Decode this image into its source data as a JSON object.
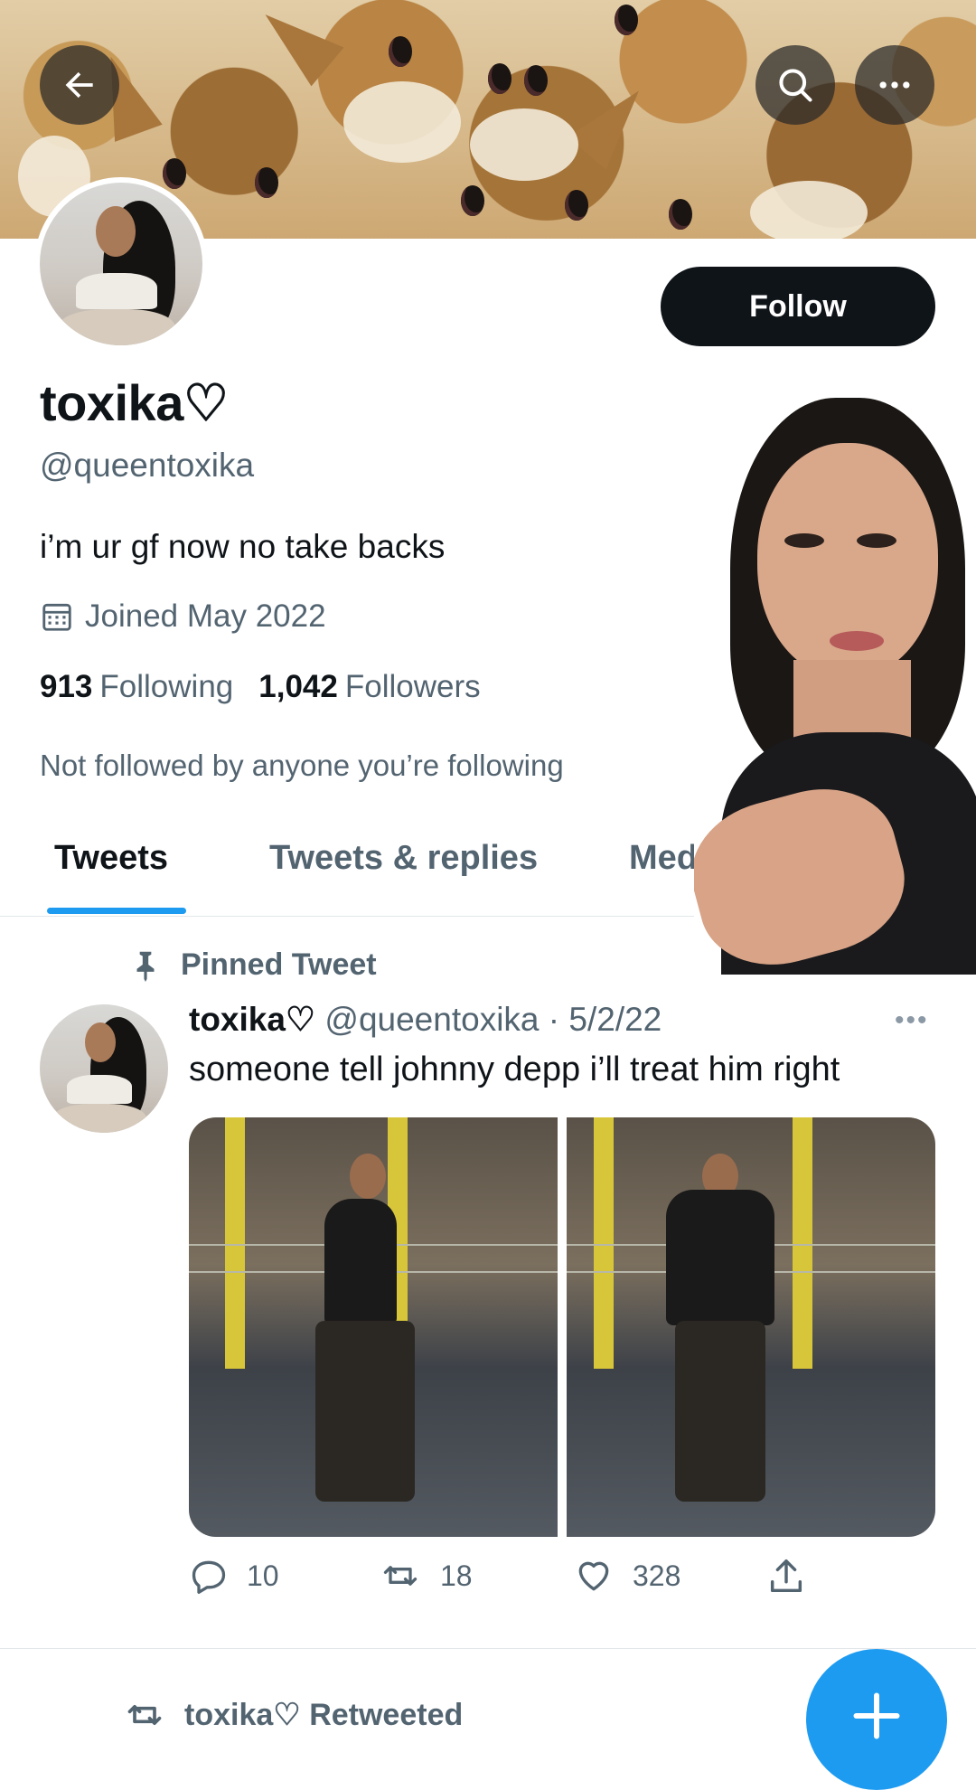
{
  "header": {
    "back_icon": "arrow-left-icon",
    "search_icon": "search-icon",
    "more_icon": "more-horizontal-icon"
  },
  "profile": {
    "display_name": "toxika♡",
    "handle": "@queentoxika",
    "bio": "i’m ur gf now no take backs",
    "joined": "Joined May 2022",
    "following_count": "913",
    "following_label": "Following",
    "followers_count": "1,042",
    "followers_label": "Followers",
    "not_followed": "Not followed by anyone you’re following",
    "follow_button": "Follow"
  },
  "tabs": [
    {
      "label": "Tweets",
      "active": true
    },
    {
      "label": "Tweets & replies",
      "active": false
    },
    {
      "label": "Medi",
      "active": false
    }
  ],
  "pinned_tweet": {
    "pinned_label": "Pinned Tweet",
    "author_name": "toxika♡",
    "author_handle": "@queentoxika",
    "date": "· 5/2/22",
    "text": "someone tell johnny depp i’ll treat him right",
    "more": "•••",
    "replies": "10",
    "retweets": "18",
    "likes": "328"
  },
  "next_item": {
    "retweeted_label": "toxika♡ Retweeted"
  },
  "colors": {
    "accent": "#1d9bf0",
    "text_primary": "#0f1419",
    "text_secondary": "#536471",
    "follow_button_bg": "#0f1419"
  }
}
